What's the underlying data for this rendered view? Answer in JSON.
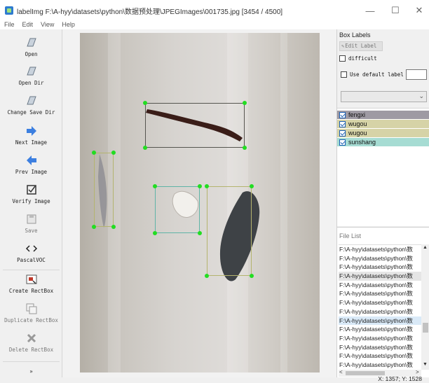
{
  "window": {
    "title": "labelImg F:\\A-hyy\\datasets\\python\\数据预处理\\JPEGImages\\001735.jpg [3454 / 4500]",
    "minimize": "—",
    "maximize": "☐",
    "close": "✕"
  },
  "menu": [
    "File",
    "Edit",
    "View",
    "Help"
  ],
  "toolbar": [
    {
      "label": "Open",
      "icon": "open-icon",
      "enabled": true
    },
    {
      "label": "Open Dir",
      "icon": "open-dir-icon",
      "enabled": true
    },
    {
      "label": "Change Save Dir",
      "icon": "change-save-dir-icon",
      "enabled": true
    },
    {
      "label": "Next Image",
      "icon": "next-arrow-icon",
      "enabled": true
    },
    {
      "label": "Prev Image",
      "icon": "prev-arrow-icon",
      "enabled": true
    },
    {
      "label": "Verify Image",
      "icon": "checkbox-icon",
      "enabled": true
    },
    {
      "label": "Save",
      "icon": "save-icon",
      "enabled": false
    },
    {
      "label": "PascalVOC",
      "icon": "code-icon",
      "enabled": true
    },
    {
      "label": "Create RectBox",
      "icon": "create-rectbox-icon",
      "enabled": true
    },
    {
      "label": "Duplicate RectBox",
      "icon": "duplicate-icon",
      "enabled": false
    },
    {
      "label": "Delete RectBox",
      "icon": "delete-icon",
      "enabled": false
    },
    {
      "label": "»",
      "icon": "more-icon",
      "enabled": true
    }
  ],
  "annotations": [
    {
      "label": "fengxi",
      "color": "#55554f",
      "checked": true
    },
    {
      "label": "wugou",
      "color": "#b4b46e",
      "checked": true
    },
    {
      "label": "wugou",
      "color": "#b4b46e",
      "checked": true
    },
    {
      "label": "sunshang",
      "color": "#5fb4a6",
      "checked": true
    }
  ],
  "box_labels": {
    "title": "Box Labels",
    "edit_label": "Edit Label",
    "difficult": "difficult",
    "use_default_label": "Use default label",
    "combo_arrow": "⌄"
  },
  "file_list": {
    "title": "File List",
    "rows": [
      "F:\\A-hyy\\datasets\\python\\数",
      "F:\\A-hyy\\datasets\\python\\数",
      "F:\\A-hyy\\datasets\\python\\数",
      "F:\\A-hyy\\datasets\\python\\数",
      "F:\\A-hyy\\datasets\\python\\数",
      "F:\\A-hyy\\datasets\\python\\数",
      "F:\\A-hyy\\datasets\\python\\数",
      "F:\\A-hyy\\datasets\\python\\数",
      "F:\\A-hyy\\datasets\\python\\数",
      "F:\\A-hyy\\datasets\\python\\数",
      "F:\\A-hyy\\datasets\\python\\数",
      "F:\\A-hyy\\datasets\\python\\数",
      "F:\\A-hyy\\datasets\\python\\数",
      "F:\\A-hyy\\datasets\\python\\数"
    ],
    "scroll_up": "▲",
    "scroll_down": "▼",
    "scroll_left": "<",
    "scroll_right": ">"
  },
  "status": {
    "coords": "X: 1357; Y: 1528"
  },
  "colors": {
    "handle": "#22dd22",
    "selected_row": "#e5e5e5"
  }
}
